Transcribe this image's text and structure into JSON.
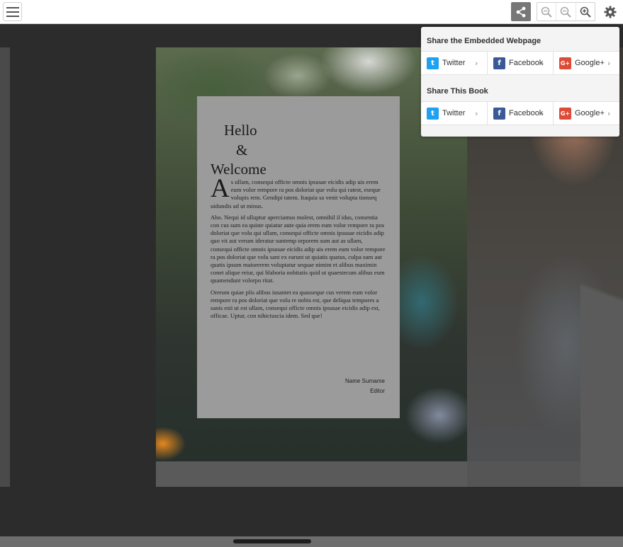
{
  "toolbar": {
    "menu_icon": "hamburger-icon",
    "share_icon": "share-icon",
    "zoom_out_icon": "zoom-out-icon",
    "zoom_fit_icon": "zoom-reset-icon",
    "zoom_in_icon": "zoom-in-icon",
    "settings_icon": "gear-icon",
    "share_active_color": "#777777"
  },
  "page": {
    "greeting_line1": "Hello",
    "greeting_line2": "&",
    "greeting_line3": "Welcome",
    "dropcap": "A",
    "paragraph1": "s ullam, consequi officte omnis ipsusae eicidis adip uis erem eum volor rempore ra pos doloriat que volu qui ratest, eseque volupis rem. Gendipi tatem. Itaquia sa venit volupta tionseq uidundis ad ut minus.",
    "paragraph2": "Abo. Nequi id ulluptur aperciamus molest, omnihil il idus, consentia con cus sum ea quiste quiatur aute quia erem eum volor rempore ra pos doloriat que volu qui ullam, consequi officte omnis ipsusae eicidis adip quo vit aut verum ideratur suntemp orporem sum aut as ullam, consequi officte omnis ipsusae eicidis adip uis erem eum volor rempore ra pos doloriat que volu sant ex earunt ut quiatis quatus, culpa sum aut quatis ipsum maiorerem voluptatur sequae nimint et alibus maximin conet alique reiur, qui blaboria nobitatis quid ut quaestecum alibus eum quamendunt volorpo ritat.",
    "paragraph3": "Orerum quiae plis alibus iusantet ea quasseque cus verem eum volor rempore ra pos doloriat que volu re nobis est, que deliqua tempores a sanis esti ut est ullam, consequi officte omnis ipsusae eicidis adip est, officae. Uptur, con nihictuscia idem. Sed que!",
    "signature_name": "Name Surname",
    "signature_role": "Editor"
  },
  "share_popover": {
    "section1_title": "Share the Embedded Webpage",
    "section2_title": "Share This Book",
    "section1_items": [
      {
        "label": "Twitter",
        "icon": "twitter-icon",
        "glyph": "t",
        "color": "#1da1f2"
      },
      {
        "label": "Facebook",
        "icon": "facebook-icon",
        "glyph": "f",
        "color": "#3b5998"
      },
      {
        "label": "Google+",
        "icon": "google-plus-icon",
        "glyph": "G+",
        "color": "#dd4b39"
      }
    ],
    "section2_items": [
      {
        "label": "Twitter",
        "icon": "twitter-icon",
        "glyph": "t",
        "color": "#1da1f2"
      },
      {
        "label": "Facebook",
        "icon": "facebook-icon",
        "glyph": "f",
        "color": "#3b5998"
      },
      {
        "label": "Google+",
        "icon": "google-plus-icon",
        "glyph": "G+",
        "color": "#dd4b39"
      }
    ],
    "chevron": "›"
  }
}
